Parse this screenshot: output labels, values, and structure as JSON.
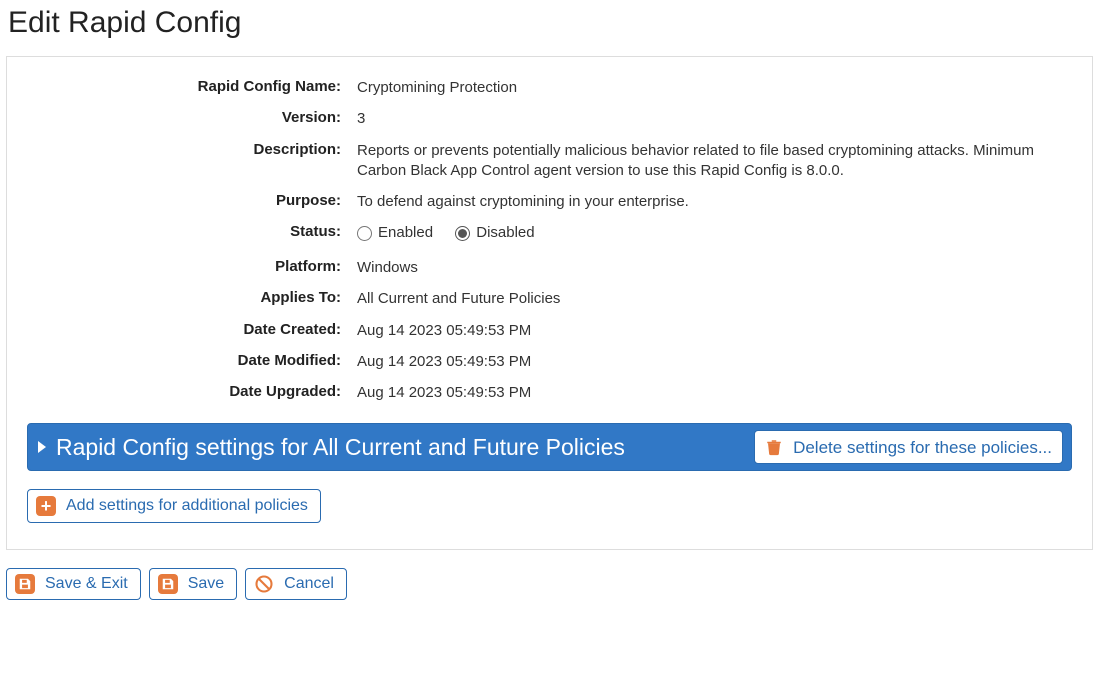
{
  "page": {
    "title": "Edit Rapid Config"
  },
  "fields": {
    "name_label": "Rapid Config Name:",
    "name_value": "Cryptomining Protection",
    "version_label": "Version:",
    "version_value": "3",
    "description_label": "Description:",
    "description_value": "Reports or prevents potentially malicious behavior related to file based cryptomining attacks. Minimum Carbon Black App Control agent version to use this Rapid Config is 8.0.0.",
    "purpose_label": "Purpose:",
    "purpose_value": "To defend against cryptomining in your enterprise.",
    "status_label": "Status:",
    "status_enabled_label": "Enabled",
    "status_disabled_label": "Disabled",
    "status_selected": "Disabled",
    "platform_label": "Platform:",
    "platform_value": "Windows",
    "applies_to_label": "Applies To:",
    "applies_to_value": "All Current and Future Policies",
    "date_created_label": "Date Created:",
    "date_created_value": "Aug 14 2023 05:49:53 PM",
    "date_modified_label": "Date Modified:",
    "date_modified_value": "Aug 14 2023 05:49:53 PM",
    "date_upgraded_label": "Date Upgraded:",
    "date_upgraded_value": "Aug 14 2023 05:49:53 PM"
  },
  "section": {
    "title": "Rapid Config settings for All Current and Future Policies",
    "delete_label": "Delete settings for these policies...",
    "add_label": "Add settings for additional policies"
  },
  "footer": {
    "save_exit_label": "Save & Exit",
    "save_label": "Save",
    "cancel_label": "Cancel"
  },
  "icons": {
    "plus": "+",
    "caret": "▶"
  }
}
